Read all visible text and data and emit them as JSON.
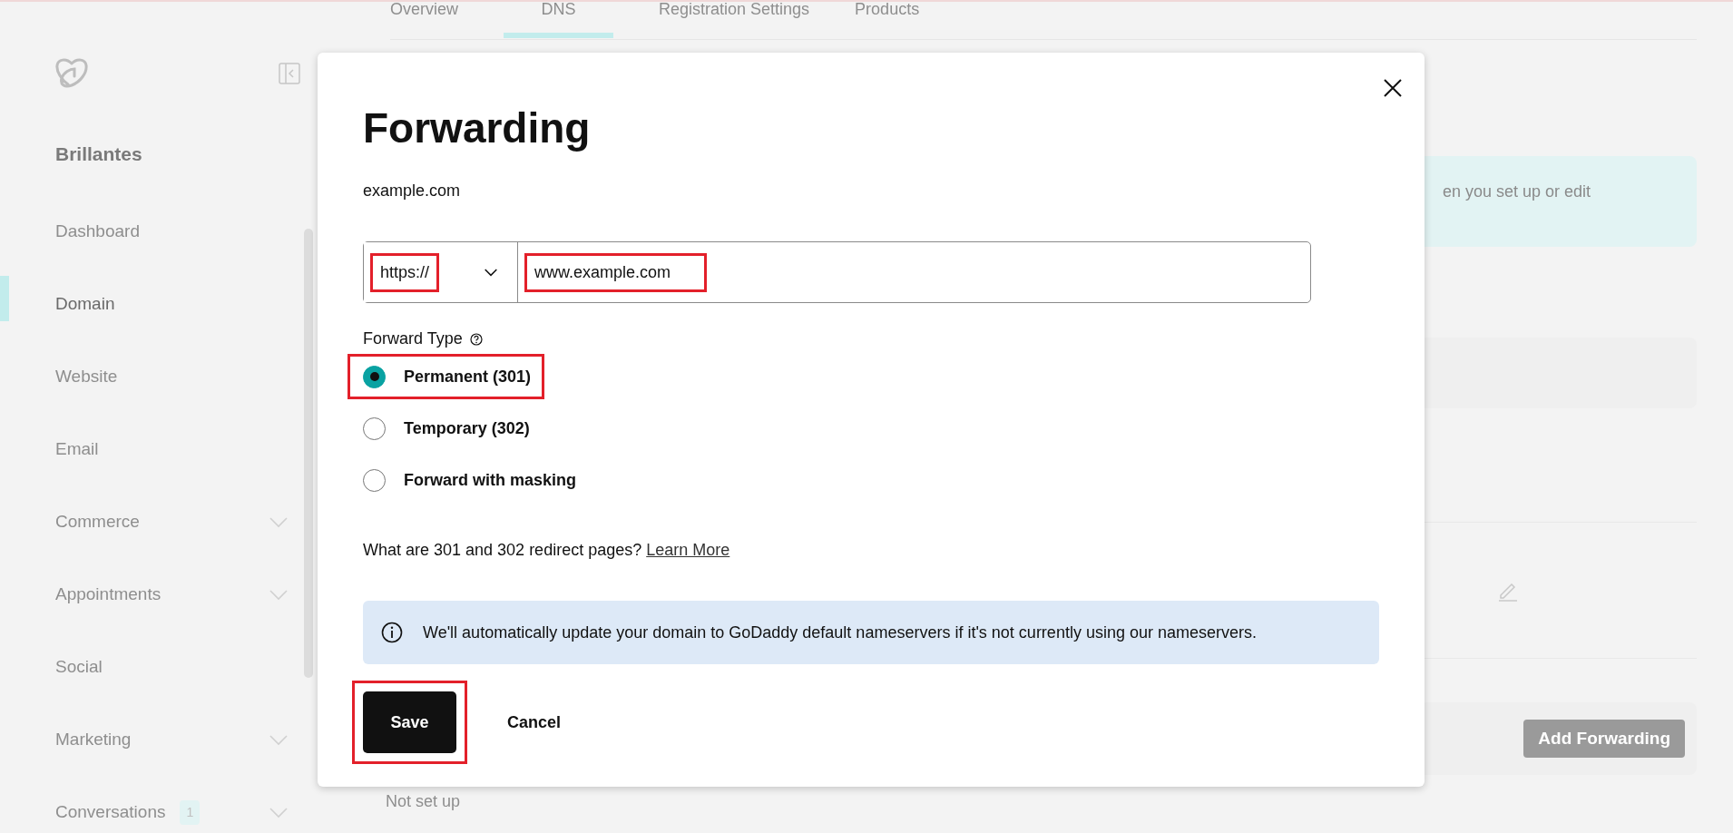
{
  "tabs": [
    {
      "label": "Overview",
      "selected": false
    },
    {
      "label": "DNS",
      "selected": true
    },
    {
      "label": "Registration Settings",
      "selected": false
    },
    {
      "label": "Products",
      "selected": false
    }
  ],
  "sidebar": {
    "brand": "Brillantes",
    "items": [
      {
        "label": "Dashboard",
        "selected": false,
        "expandable": false
      },
      {
        "label": "Domain",
        "selected": true,
        "expandable": false
      },
      {
        "label": "Website",
        "selected": false,
        "expandable": false
      },
      {
        "label": "Email",
        "selected": false,
        "expandable": false
      },
      {
        "label": "Commerce",
        "selected": false,
        "expandable": true
      },
      {
        "label": "Appointments",
        "selected": false,
        "expandable": true
      },
      {
        "label": "Social",
        "selected": false,
        "expandable": false
      },
      {
        "label": "Marketing",
        "selected": false,
        "expandable": true
      },
      {
        "label": "Conversations",
        "selected": false,
        "expandable": true,
        "badge": "1"
      }
    ]
  },
  "background": {
    "notice_text": "en you set up or edit",
    "add_button": "Add Forwarding",
    "status": "Not set up"
  },
  "dialog": {
    "title": "Forwarding",
    "domain": "example.com",
    "protocol": {
      "value": "https://",
      "highlighted": true
    },
    "url": {
      "value": "www.example.com",
      "highlighted": true
    },
    "forward_type_label": "Forward Type",
    "options": [
      {
        "label": "Permanent (301)",
        "selected": true,
        "highlighted": true
      },
      {
        "label": "Temporary (302)",
        "selected": false,
        "highlighted": false
      },
      {
        "label": "Forward with masking",
        "selected": false,
        "highlighted": false
      }
    ],
    "help_text": "What are 301 and 302 redirect pages?",
    "help_link": "Learn More",
    "info": "We'll automatically update your domain to GoDaddy default nameservers if it's not currently using our nameservers.",
    "save": {
      "label": "Save",
      "highlighted": true
    },
    "cancel": "Cancel"
  }
}
